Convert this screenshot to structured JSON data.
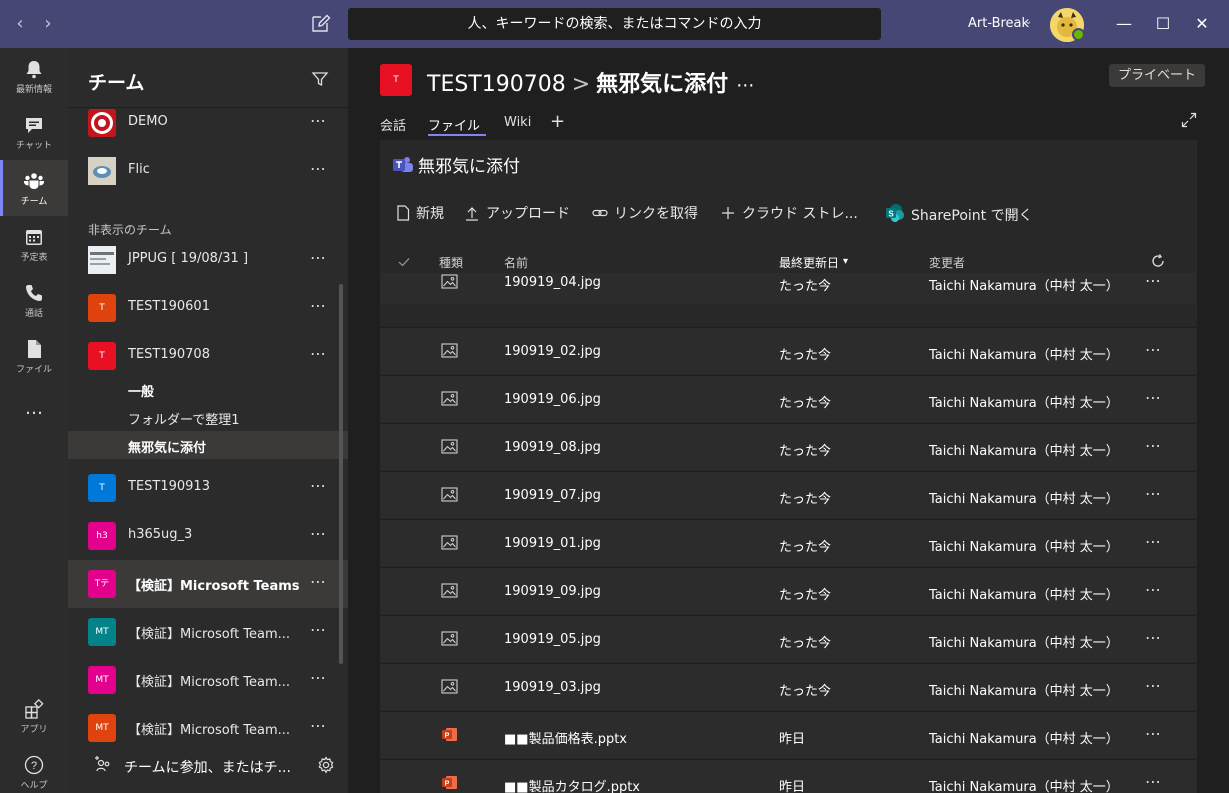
{
  "titlebar": {
    "search_placeholder": "人、キーワードの検索、またはコマンドの入力",
    "tenant": "Art-Break",
    "back": "‹",
    "forward": "›",
    "minimize": "—",
    "maximize": "☐",
    "close": "✕"
  },
  "rail": {
    "items": [
      {
        "label": "最新情報"
      },
      {
        "label": "チャット"
      },
      {
        "label": "チーム"
      },
      {
        "label": "予定表"
      },
      {
        "label": "通話"
      },
      {
        "label": "ファイル"
      },
      {
        "label": "…"
      },
      {
        "label": "アプリ"
      },
      {
        "label": "ヘルプ"
      }
    ]
  },
  "teams": {
    "title": "チーム",
    "hidden_label": "非表示のチーム",
    "more": "⋯",
    "list": [
      {
        "name": "DEMO",
        "abbr": "",
        "color": "#c2161e"
      },
      {
        "name": "Flic",
        "abbr": "",
        "color": "#8a8f94"
      },
      {
        "name": "JPPUG [ 19/08/31 ]",
        "abbr": "",
        "color": "#cfd3d6"
      },
      {
        "name": "TEST190601",
        "abbr": "T",
        "color": "#e0440e"
      },
      {
        "name": "TEST190708",
        "abbr": "T",
        "color": "#e81123"
      },
      {
        "name": "TEST190913",
        "abbr": "T",
        "color": "#0078d7"
      },
      {
        "name": "h365ug_3",
        "abbr": "h3",
        "color": "#e3008c"
      },
      {
        "name": "【検証】Microsoft Teams",
        "abbr": "Tテ",
        "color": "#e3008c"
      },
      {
        "name": "【検証】Microsoft Team...",
        "abbr": "MT",
        "color": "#038387"
      },
      {
        "name": "【検証】Microsoft Team...",
        "abbr": "MT",
        "color": "#e3008c"
      },
      {
        "name": "【検証】Microsoft Team...",
        "abbr": "MT",
        "color": "#e0440e"
      }
    ],
    "channels": [
      {
        "name": "一般"
      },
      {
        "name": "フォルダーで整理1"
      },
      {
        "name": "無邪気に添付"
      }
    ],
    "join_label": "チームに参加、またはチ..."
  },
  "main": {
    "team_abbr": "T",
    "team_name": "TEST190708",
    "separator": ">",
    "channel_name": "無邪気に添付",
    "more": "⋯",
    "private_badge": "プライベート",
    "tabs": [
      {
        "label": "会話"
      },
      {
        "label": "ファイル"
      },
      {
        "label": "Wiki"
      }
    ],
    "tab_add": "+",
    "panel_title": "無邪気に添付",
    "commands": {
      "new": "新規",
      "upload": "アップロード",
      "get_link": "リンクを取得",
      "cloud": "クラウド ストレ...",
      "sharepoint": "SharePoint で開く"
    },
    "columns": {
      "type": "種類",
      "name": "名前",
      "modified": "最終更新日",
      "sort_indicator": "▾",
      "modified_by": "変更者"
    },
    "files": [
      {
        "type": "image",
        "name": "190919_04.jpg",
        "modified": "たった今",
        "by": "Taichi Nakamura（中村 太一）"
      },
      {
        "type": "image",
        "name": "190919_02.jpg",
        "modified": "たった今",
        "by": "Taichi Nakamura（中村 太一）"
      },
      {
        "type": "image",
        "name": "190919_06.jpg",
        "modified": "たった今",
        "by": "Taichi Nakamura（中村 太一）"
      },
      {
        "type": "image",
        "name": "190919_08.jpg",
        "modified": "たった今",
        "by": "Taichi Nakamura（中村 太一）"
      },
      {
        "type": "image",
        "name": "190919_07.jpg",
        "modified": "たった今",
        "by": "Taichi Nakamura（中村 太一）"
      },
      {
        "type": "image",
        "name": "190919_01.jpg",
        "modified": "たった今",
        "by": "Taichi Nakamura（中村 太一）"
      },
      {
        "type": "image",
        "name": "190919_09.jpg",
        "modified": "たった今",
        "by": "Taichi Nakamura（中村 太一）"
      },
      {
        "type": "image",
        "name": "190919_05.jpg",
        "modified": "たった今",
        "by": "Taichi Nakamura（中村 太一）"
      },
      {
        "type": "image",
        "name": "190919_03.jpg",
        "modified": "たった今",
        "by": "Taichi Nakamura（中村 太一）"
      },
      {
        "type": "pptx",
        "name": "■■製品価格表.pptx",
        "modified": "昨日",
        "by": "Taichi Nakamura（中村 太一）"
      },
      {
        "type": "pptx",
        "name": "■■製品カタログ.pptx",
        "modified": "昨日",
        "by": "Taichi Nakamura（中村 太一）"
      }
    ]
  }
}
